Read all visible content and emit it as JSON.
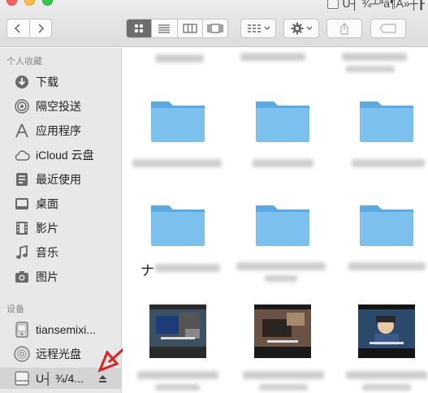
{
  "window": {
    "title": "U┤ ¾┴ªã¶A»┼┠"
  },
  "toolbar": {
    "back_icon": "chevron-left-icon",
    "forward_icon": "chevron-right-icon",
    "view_modes": [
      "icon-view-icon",
      "list-view-icon",
      "column-view-icon",
      "gallery-view-icon"
    ],
    "arrange_icon": "arrange-grid-icon",
    "action_icon": "gear-icon",
    "share_icon": "share-icon",
    "tag_icon": "tag-icon"
  },
  "sidebar": {
    "favorites_header": "个人收藏",
    "favorites": [
      {
        "label": "下载",
        "icon": "download-icon"
      },
      {
        "label": "隔空投送",
        "icon": "airdrop-icon"
      },
      {
        "label": "应用程序",
        "icon": "applications-icon"
      },
      {
        "label": "iCloud 云盘",
        "icon": "cloud-icon"
      },
      {
        "label": "最近使用",
        "icon": "recents-icon"
      },
      {
        "label": "桌面",
        "icon": "desktop-icon"
      },
      {
        "label": "影片",
        "icon": "film-icon"
      },
      {
        "label": "音乐",
        "icon": "music-note-icon"
      },
      {
        "label": "图片",
        "icon": "camera-icon"
      }
    ],
    "devices_header": "设备",
    "devices": [
      {
        "label": "tiansemixi...",
        "icon": "disk-icon"
      },
      {
        "label": "远程光盘",
        "icon": "optical-disc-icon"
      },
      {
        "label": "U┤ ¾/4...",
        "icon": "external-drive-icon",
        "selected": true
      }
    ]
  },
  "content": {
    "partial_label": "ナ",
    "colors": {
      "folder": "#7cc0ee",
      "folder_dark": "#5aa9e3"
    }
  },
  "annotation": {
    "arrow_color": "#e02020"
  }
}
